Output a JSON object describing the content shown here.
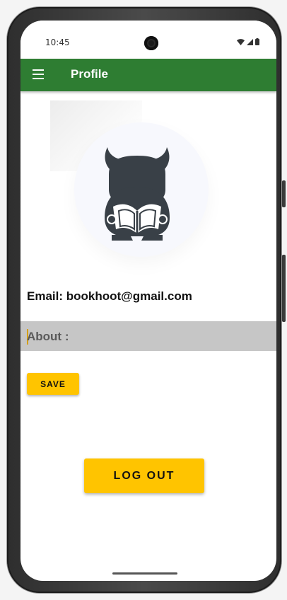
{
  "status_bar": {
    "time": "10:45",
    "icons": [
      "wifi-icon",
      "cell-signal-icon",
      "battery-icon"
    ]
  },
  "app_bar": {
    "title": "Profile",
    "menu_icon": "menu-icon",
    "background_color": "#2e7d32"
  },
  "profile": {
    "avatar_icon": "owl-reading-book-icon",
    "email_text": "Email: bookhoot@gmail.com",
    "about_placeholder": "About :"
  },
  "actions": {
    "save_label": "SAVE",
    "logout_label": "LOG OUT",
    "button_color": "#ffc400"
  }
}
